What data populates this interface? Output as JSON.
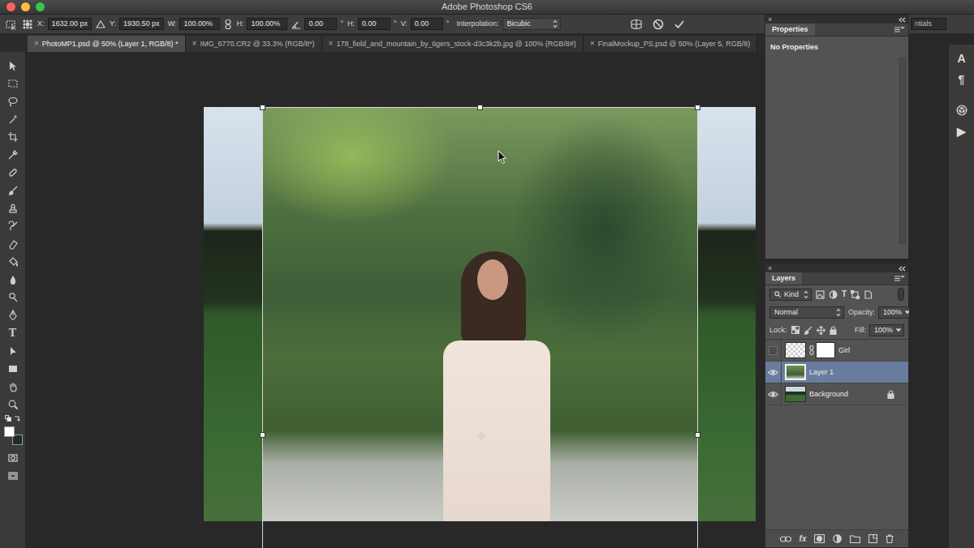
{
  "window": {
    "title": "Adobe Photoshop CS6"
  },
  "options_bar": {
    "fields": [
      {
        "label": "X:",
        "value": "1632.00 px"
      },
      {
        "label": "Y:",
        "value": "1930.50 px"
      },
      {
        "label": "W:",
        "value": "100.00%"
      },
      {
        "label": "H:",
        "value": "100.00%"
      },
      {
        "value": "0.00",
        "unit": "°"
      },
      {
        "label": "H:",
        "value": "0.00",
        "unit": "°"
      },
      {
        "label": "V:",
        "value": "0.00",
        "unit": "°"
      }
    ],
    "interpolation": {
      "label": "Interpolation:",
      "value": "Bicubic"
    },
    "workspace": "ntials"
  },
  "tabs": [
    {
      "label": "PhotoMP1.psd @ 50% (Layer 1, RGB/8) *",
      "selected": true,
      "close": "×"
    },
    {
      "label": "IMG_6770.CR2 @ 33.3% (RGB/8*)",
      "selected": false,
      "close": "×"
    },
    {
      "label": "178_field_and_mountain_by_tigers_stock-d3c3k2b.jpg @ 100% (RGB/8#)",
      "selected": false,
      "close": "×"
    },
    {
      "label": "FinalMockup_PS.psd @ 50% (Layer 5, RGB/8)",
      "selected": false,
      "close": "×"
    }
  ],
  "tools": {
    "type_glyph": "T",
    "foreground_color": "#ffffff",
    "background_color": "#1d2d22"
  },
  "panels": {
    "properties": {
      "close": "×",
      "title": "Properties",
      "message": "No Properties"
    },
    "layers": {
      "close": "×",
      "title": "Layers",
      "filter": "Kind",
      "filter_type_glyph": "T",
      "blend_mode": "Normal",
      "opacity_label": "Opacity:",
      "opacity": "100%",
      "lock_label": "Lock:",
      "fill_label": "Fill:",
      "fill": "100%",
      "items": [
        {
          "name": "Girl",
          "visible": false,
          "selected": false,
          "locked": false,
          "mask": true
        },
        {
          "name": "Layer 1",
          "visible": true,
          "selected": true,
          "locked": false,
          "mask": false
        },
        {
          "name": "Background",
          "visible": true,
          "selected": false,
          "locked": true,
          "mask": false
        }
      ],
      "footer_fx": "fx"
    }
  },
  "dock_icons": [
    {
      "kind": "glyph",
      "glyph": "A"
    },
    {
      "kind": "glyph",
      "glyph": "¶"
    },
    {
      "kind": "svg"
    },
    {
      "kind": "glyph",
      "glyph": "▶"
    }
  ]
}
